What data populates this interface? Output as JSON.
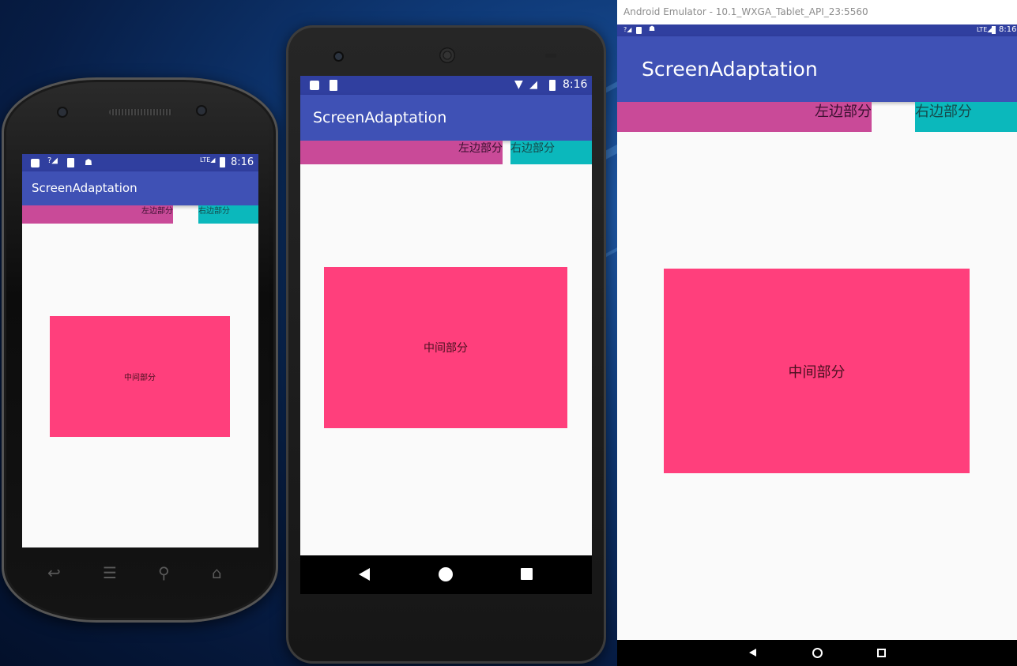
{
  "app": {
    "title": "ScreenAdaptation",
    "left_label": "左边部分",
    "right_label": "右边部分",
    "center_label": "中间部分",
    "status_time": "8:16"
  },
  "emulator": {
    "window_title": "Android Emulator - 10.1_WXGA_Tablet_API_23:5560"
  },
  "colors": {
    "status_bar": "#303f9f",
    "app_bar": "#3f51b5",
    "left_part": "#c94a98",
    "right_part": "#0bb8bc",
    "center_part": "#ff3f7c",
    "background": "#fafafa"
  },
  "icons": {
    "phone1_status_left": [
      "notification-square-icon",
      "signal-question-icon",
      "sd-card-icon",
      "android-debug-icon"
    ],
    "phone1_status_right": [
      "lte-icon",
      "battery-charging-icon"
    ],
    "phone1_nav": [
      "back-icon",
      "menu-icon",
      "search-icon",
      "home-icon"
    ],
    "phone2_status_left": [
      "notification-square-icon",
      "sd-card-icon"
    ],
    "phone2_status_right": [
      "wifi-icon",
      "signal-icon",
      "battery-charging-icon"
    ],
    "phone2_nav": [
      "back-triangle-icon",
      "home-circle-icon",
      "recents-square-icon"
    ],
    "tablet_nav": [
      "back-triangle-icon",
      "home-circle-icon",
      "recents-square-icon"
    ]
  }
}
